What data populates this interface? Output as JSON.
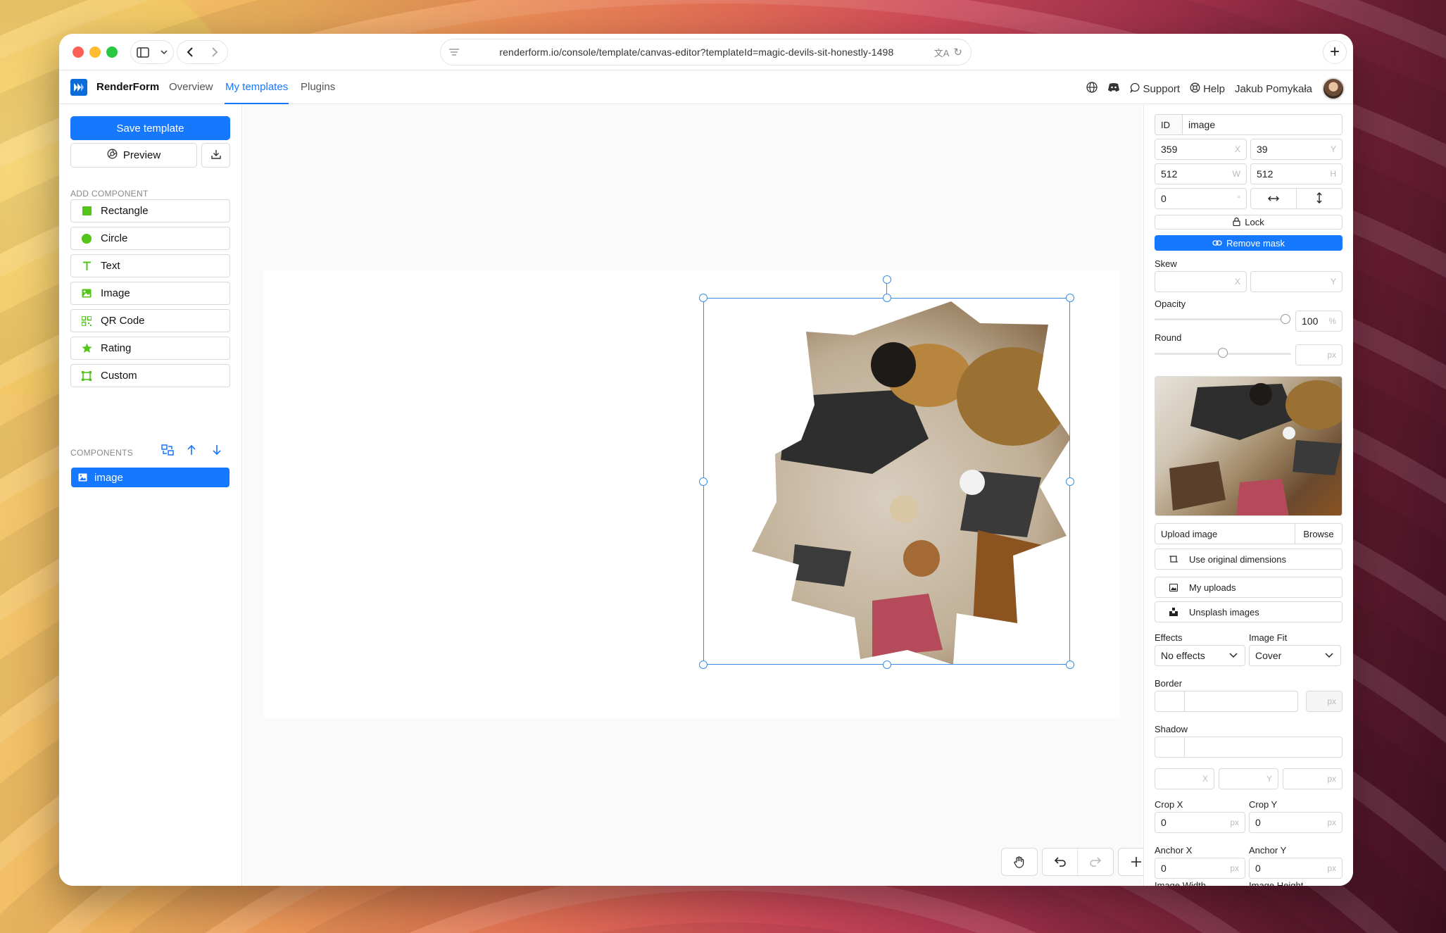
{
  "browser": {
    "url": "renderform.io/console/template/canvas-editor?templateId=magic-devils-sit-honestly-1498"
  },
  "app": {
    "brand": "RenderForm",
    "nav": [
      {
        "label": "Overview"
      },
      {
        "label": "My templates",
        "active": true
      },
      {
        "label": "Plugins"
      }
    ],
    "support_label": "Support",
    "help_label": "Help",
    "user_name": "Jakub Pomykała"
  },
  "left": {
    "save_label": "Save template",
    "preview_label": "Preview",
    "add_component_label": "ADD COMPONENT",
    "components": [
      {
        "label": "Rectangle",
        "icon": "square-icon"
      },
      {
        "label": "Circle",
        "icon": "circle-icon"
      },
      {
        "label": "Text",
        "icon": "text-icon"
      },
      {
        "label": "Image",
        "icon": "image-icon"
      },
      {
        "label": "QR Code",
        "icon": "qr-code-icon"
      },
      {
        "label": "Rating",
        "icon": "star-icon"
      },
      {
        "label": "Custom",
        "icon": "custom-frame-icon"
      }
    ],
    "layers_label": "COMPONENTS",
    "layers": [
      {
        "label": "image"
      }
    ]
  },
  "props": {
    "id_label": "ID",
    "id_value": "image",
    "x": "359",
    "x_suffix": "X",
    "y": "39",
    "y_suffix": "Y",
    "w": "512",
    "w_suffix": "W",
    "h": "512",
    "h_suffix": "H",
    "rotation": "0",
    "rotation_suffix": "°",
    "lock_label": "Lock",
    "remove_mask_label": "Remove mask",
    "skew_label": "Skew",
    "skew_x_suffix": "X",
    "skew_y_suffix": "Y",
    "opacity_label": "Opacity",
    "opacity_value": "100",
    "opacity_suffix": "%",
    "opacity_level": 1.0,
    "round_label": "Round",
    "round_suffix": "px",
    "round_level": 0.5,
    "upload_label": "Upload image",
    "browse_label": "Browse",
    "use_original_label": "Use original dimensions",
    "my_uploads_label": "My uploads",
    "unsplash_label": "Unsplash images",
    "effects_label": "Effects",
    "effects_value": "No effects",
    "image_fit_label": "Image Fit",
    "image_fit_value": "Cover",
    "border_label": "Border",
    "border_suffix": "px",
    "shadow_label": "Shadow",
    "shadow_x_suffix": "X",
    "shadow_y_suffix": "Y",
    "shadow_px_suffix": "px",
    "crop_x_label": "Crop X",
    "crop_x_value": "0",
    "crop_y_label": "Crop Y",
    "crop_y_value": "0",
    "anchor_x_label": "Anchor X",
    "anchor_x_value": "0",
    "anchor_y_label": "Anchor Y",
    "anchor_y_value": "0",
    "px_suffix": "px",
    "image_width_label": "Image Width",
    "image_height_label": "Image Height"
  },
  "colors": {
    "accent": "#1677ff",
    "component_icon": "#52c41a"
  }
}
